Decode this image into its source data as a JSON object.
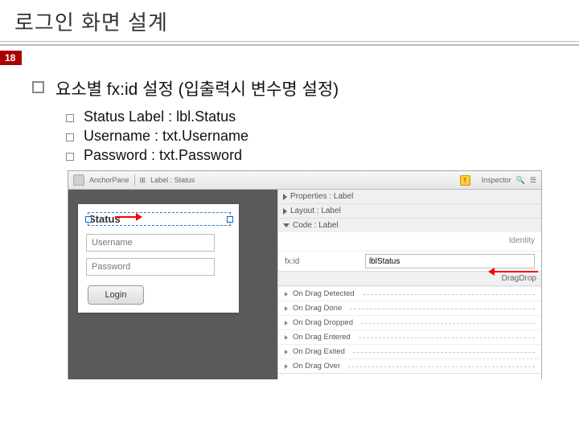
{
  "page_number": "18",
  "title": "로그인 화면 설계",
  "lvl1": "요소별 fx:id 설정 (입출력시 변수명 설정)",
  "lvl2": [
    "Status Label : lbl.Status",
    "Username : txt.Username",
    "Password : txt.Password"
  ],
  "toolbar": {
    "anchor": "AnchorPane",
    "label_glyph": "⊞",
    "label_text": "Label : Status",
    "inspector": "Inspector",
    "search_glyph": "🔍",
    "menu_glyph": "☰"
  },
  "canvas_form": {
    "status": "Status",
    "username_ph": "Username",
    "password_ph": "Password",
    "login": "Login"
  },
  "props": {
    "section_properties": "Properties : Label",
    "section_layout": "Layout : Label",
    "section_code": "Code : Label",
    "identity": "Identity",
    "fxid_label": "fx:id",
    "fxid_value": "lblStatus",
    "dragdrop": "DragDrop",
    "events": [
      "On Drag Detected",
      "On Drag Done",
      "On Drag Dropped",
      "On Drag Entered",
      "On Drag Exited",
      "On Drag Over"
    ]
  }
}
